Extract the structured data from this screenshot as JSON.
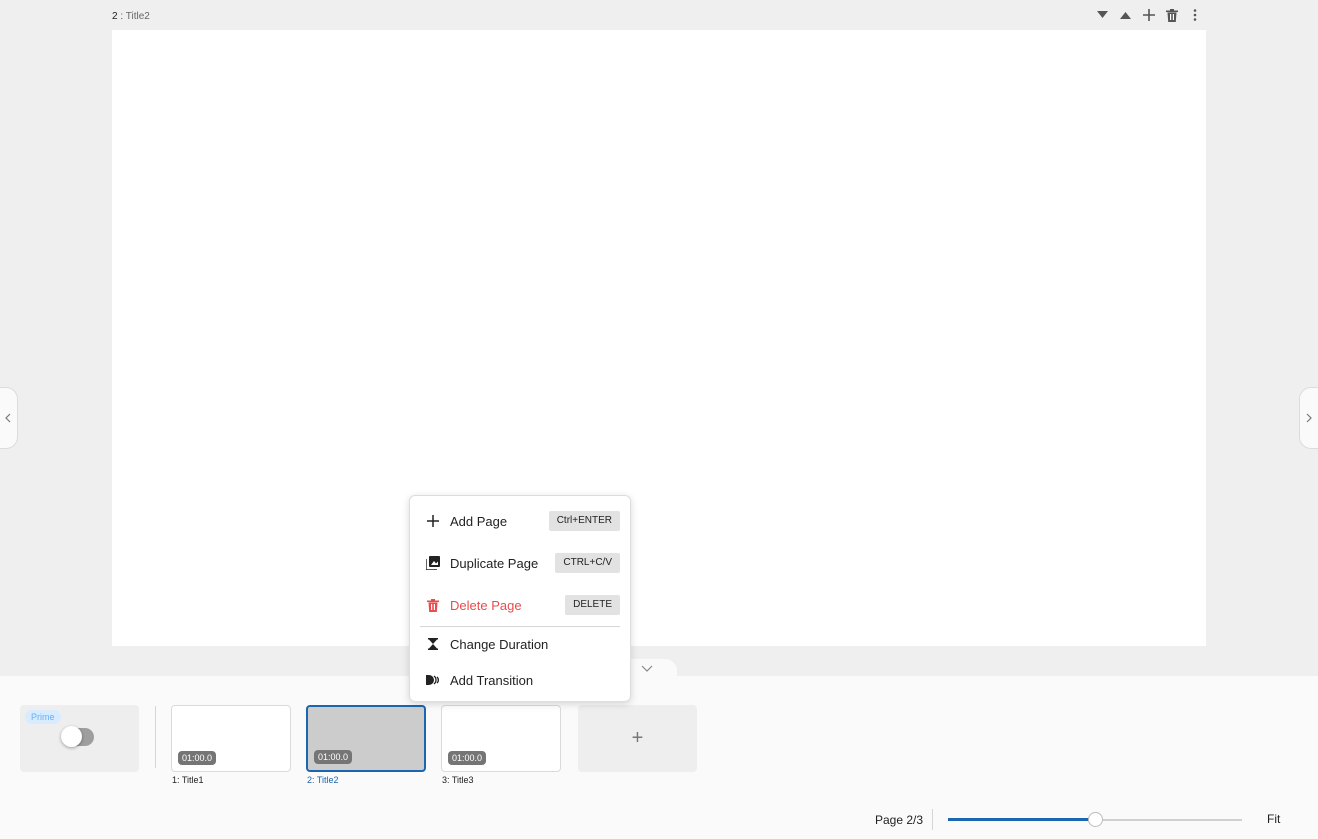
{
  "page_header": {
    "number": "2",
    "separator": ":",
    "title": "Title2"
  },
  "page_tools": {
    "move_down_icon": "triangle-down-icon",
    "move_up_icon": "triangle-up-icon",
    "add_icon": "plus-icon",
    "delete_icon": "trash-icon",
    "more_icon": "kebab-icon"
  },
  "context_menu": {
    "items": [
      {
        "label": "Add Page",
        "shortcut": "Ctrl+ENTER",
        "icon": "plus-icon"
      },
      {
        "label": "Duplicate Page",
        "shortcut": "CTRL+C/V",
        "icon": "duplicate-icon"
      },
      {
        "label": "Delete Page",
        "shortcut": "DELETE",
        "icon": "trash-icon",
        "color": "#e84c4c"
      },
      {
        "label": "Change Duration",
        "icon": "hourglass-icon"
      },
      {
        "label": "Add Transition",
        "icon": "transition-icon"
      }
    ]
  },
  "prime": {
    "badge": "Prime",
    "toggle_on": false
  },
  "thumbnails": [
    {
      "duration": "01:00.0",
      "label": "1: Title1",
      "active": false
    },
    {
      "duration": "01:00.0",
      "label": "2: Title2",
      "active": true
    },
    {
      "duration": "01:00.0",
      "label": "3: Title3",
      "active": false
    }
  ],
  "add_thumbnail_label": "+",
  "footer": {
    "page_info": "Page 2/3",
    "zoom_level": 0.5,
    "fit_label": "Fit"
  },
  "colors": {
    "accent": "#1a66b0",
    "danger": "#e84c4c",
    "prime_badge_bg": "#d8ecff",
    "prime_badge_text": "#6aaef0"
  }
}
